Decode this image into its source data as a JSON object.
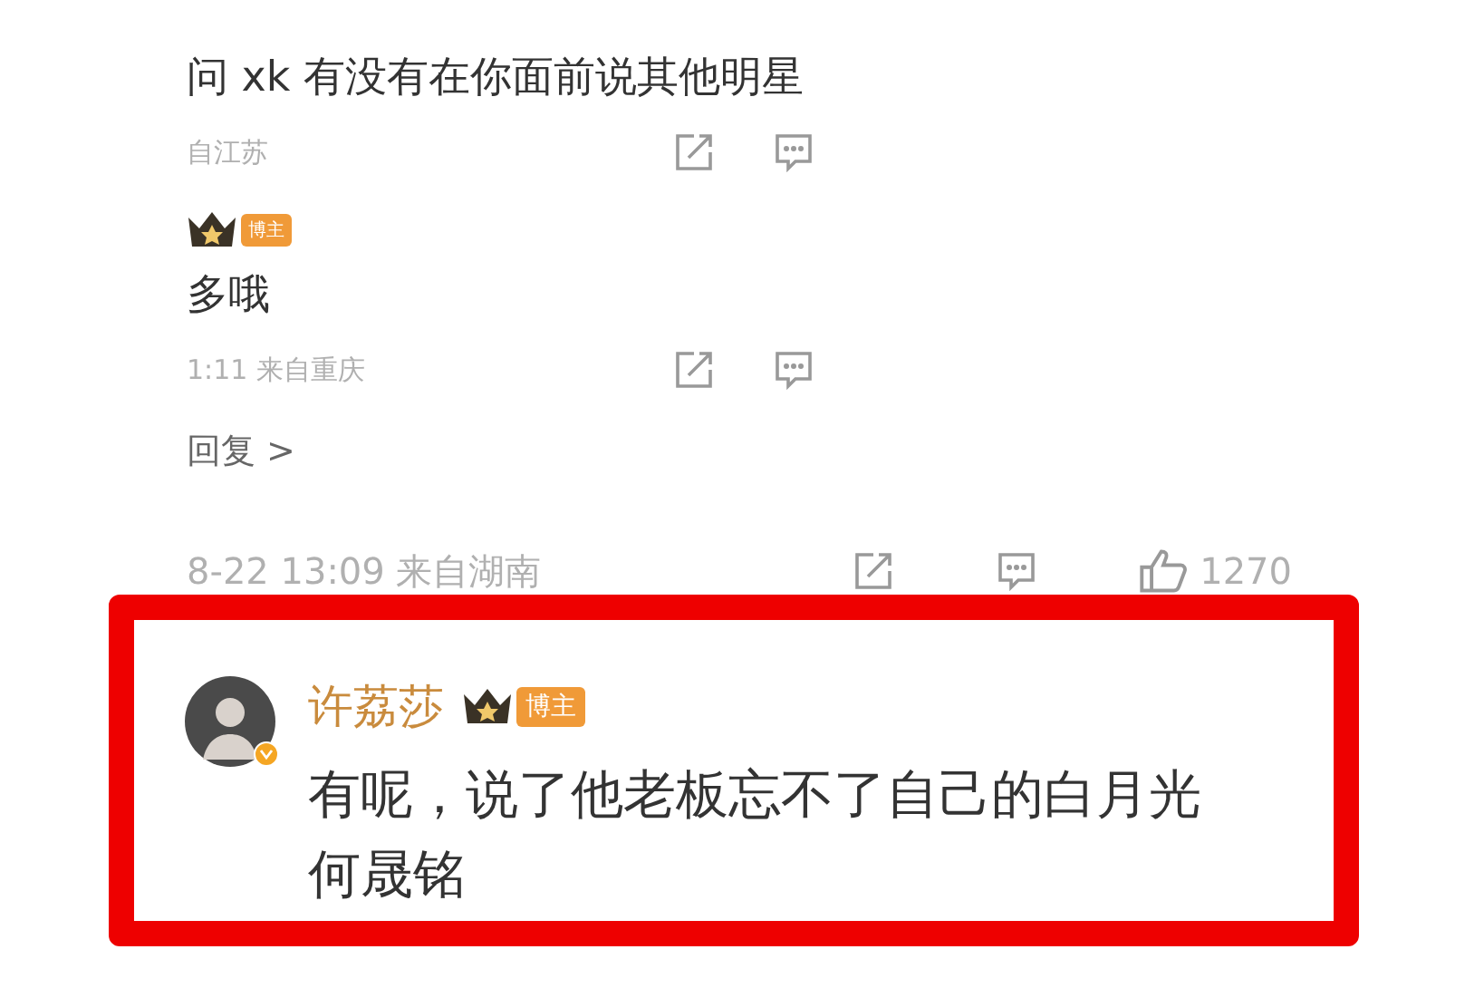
{
  "replies": [
    {
      "text": "问 xk 有没有在你面前说其他明星",
      "meta": "自江苏"
    },
    {
      "badge": "博主",
      "text": "多哦",
      "meta": "1:11 来自重庆"
    }
  ],
  "more_replies": "回复 >",
  "comment_meta": {
    "time_location": "8-22 13:09 来自湖南",
    "likes": "1270"
  },
  "highlighted_comment": {
    "user": "许荔莎",
    "badge": "博主",
    "verified": true,
    "text": "有呢，说了他老板忘不了自己的白月光何晟铭"
  }
}
